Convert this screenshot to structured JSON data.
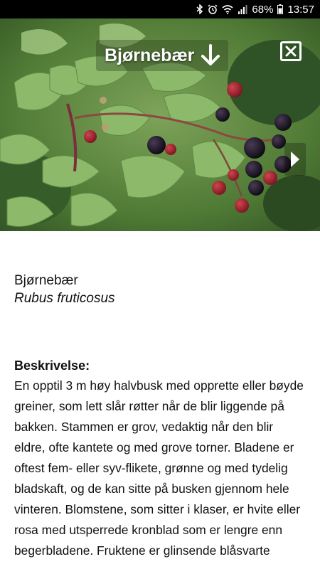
{
  "status_bar": {
    "battery": "68%",
    "time": "13:57"
  },
  "hero": {
    "title": "Bjørnebær",
    "icons": {
      "download": "arrow-down-icon",
      "close": "close-box-icon",
      "next": "chevron-right-icon"
    }
  },
  "species": {
    "common_name": "Bjørnebær",
    "latin_name": "Rubus fruticosus"
  },
  "description": {
    "heading": "Beskrivelse:",
    "text": "En opptil 3 m høy halvbusk med opprette eller bøyde greiner, som lett slår røtter når de blir liggende på bakken. Stammen er grov, vedaktig når den blir eldre, ofte kantete og med grove torner. Bladene er oftest fem- eller syv-flikete, grønne og med tydelig bladskaft, og de kan sitte på busken gjennom hele vinteren. Blomstene, som sitter i klaser, er hvite eller rosa med utsperrede kronblad som er lengre enn begerbladene. Fruktene er glinsende blåsvarte"
  }
}
